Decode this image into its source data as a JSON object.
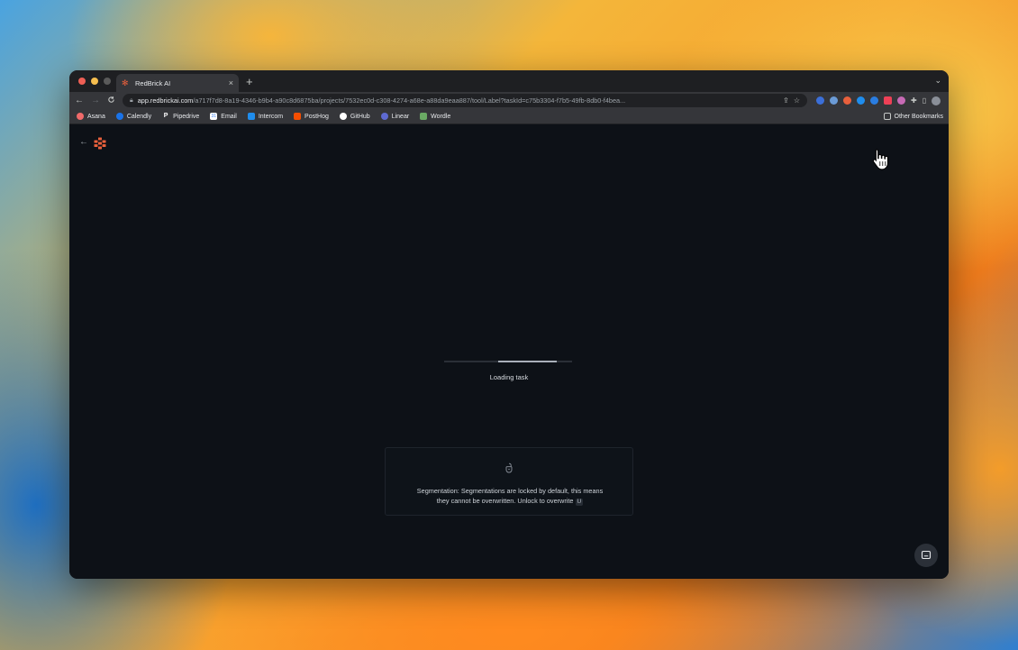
{
  "browser": {
    "tab": {
      "title": "RedBrick AI",
      "close": "×"
    },
    "new_tab": "+",
    "tab_menu": "⌄",
    "nav": {
      "back": "←",
      "forward": "→",
      "reload": "C"
    },
    "url": {
      "host": "app.redbrickai.com",
      "path": "/a717f7d8-8a19-4346-b9b4-a90c8d6875ba/projects/7532ec0d-c308-4274-a68e-a88da9eaa887/tool/Label?taskId=c75b3304-f7b5-49fb-8db0-f4bea..."
    },
    "bookmarks": [
      {
        "label": "Asana",
        "icon": "asana-icon",
        "color": "#f06a6a"
      },
      {
        "label": "Calendly",
        "icon": "calendly-icon",
        "color": "#1a73e8"
      },
      {
        "label": "Pipedrive",
        "icon": "pipedrive-icon",
        "color": "#ffffff"
      },
      {
        "label": "Email",
        "icon": "email-icon",
        "color": "#4285f4"
      },
      {
        "label": "Intercom",
        "icon": "intercom-icon",
        "color": "#1f8ded"
      },
      {
        "label": "PostHog",
        "icon": "posthog-icon",
        "color": "#f54e00"
      },
      {
        "label": "GitHub",
        "icon": "github-icon",
        "color": "#ffffff"
      },
      {
        "label": "Linear",
        "icon": "linear-icon",
        "color": "#5e6ad2"
      },
      {
        "label": "Wordle",
        "icon": "wordle-icon",
        "color": "#6aaa64"
      }
    ],
    "other_bookmarks": "Other Bookmarks"
  },
  "app": {
    "back_icon": "←",
    "brand_color": "#e8603c",
    "loading_text": "Loading task",
    "loading_progress": 0.46,
    "hint_line1": "Segmentation: Segmentations are locked by default, this means",
    "hint_line2": "they cannot be overwritten. Unlock to overwrite",
    "hint_key": "U"
  }
}
